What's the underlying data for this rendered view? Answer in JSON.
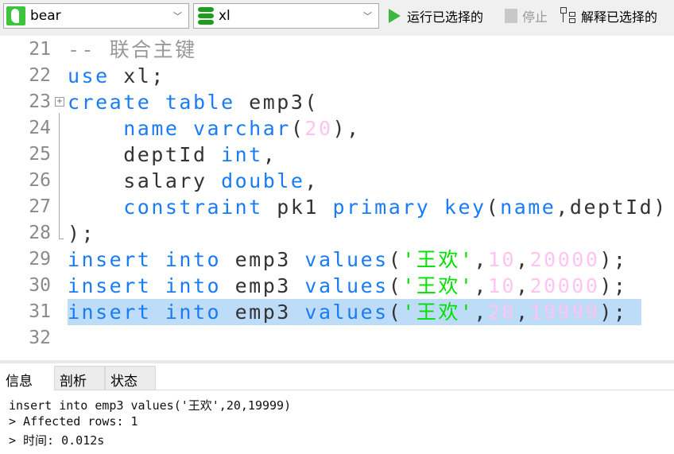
{
  "toolbar": {
    "connection": "bear",
    "database": "xl",
    "run_selected": "运行已选择的",
    "stop": "停止",
    "explain_selected": "解释已选择的"
  },
  "editor": {
    "lines": [
      {
        "num": "21",
        "tokens": [
          [
            "c",
            "-- 联合主键"
          ]
        ]
      },
      {
        "num": "22",
        "tokens": [
          [
            "k",
            "use"
          ],
          [
            "p",
            " xl;"
          ]
        ]
      },
      {
        "num": "23",
        "fold": true,
        "tokens": [
          [
            "k",
            "create table"
          ],
          [
            "p",
            " emp3("
          ]
        ]
      },
      {
        "num": "24",
        "tokens": [
          [
            "p",
            "    "
          ],
          [
            "k",
            "name varchar"
          ],
          [
            "p",
            "("
          ],
          [
            "n",
            "20"
          ],
          [
            "p",
            "),"
          ]
        ]
      },
      {
        "num": "25",
        "tokens": [
          [
            "p",
            "    deptId "
          ],
          [
            "k",
            "int"
          ],
          [
            "p",
            ","
          ]
        ]
      },
      {
        "num": "26",
        "tokens": [
          [
            "p",
            "    salary "
          ],
          [
            "k",
            "double"
          ],
          [
            "p",
            ","
          ]
        ]
      },
      {
        "num": "27",
        "tokens": [
          [
            "p",
            "    "
          ],
          [
            "k",
            "constraint"
          ],
          [
            "p",
            " pk1 "
          ],
          [
            "k",
            "primary key"
          ],
          [
            "p",
            "("
          ],
          [
            "k",
            "name"
          ],
          [
            "p",
            ",deptId)"
          ]
        ]
      },
      {
        "num": "28",
        "tokens": [
          [
            "p",
            ");"
          ]
        ]
      },
      {
        "num": "29",
        "tokens": [
          [
            "k",
            "insert into"
          ],
          [
            "p",
            " emp3 "
          ],
          [
            "k",
            "values"
          ],
          [
            "p",
            "("
          ],
          [
            "s",
            "'王欢'"
          ],
          [
            "p",
            ","
          ],
          [
            "n",
            "10"
          ],
          [
            "p",
            ","
          ],
          [
            "n",
            "20000"
          ],
          [
            "p",
            ");"
          ]
        ]
      },
      {
        "num": "30",
        "tokens": [
          [
            "k",
            "insert into"
          ],
          [
            "p",
            " emp3 "
          ],
          [
            "k",
            "values"
          ],
          [
            "p",
            "("
          ],
          [
            "s",
            "'王欢'"
          ],
          [
            "p",
            ","
          ],
          [
            "n",
            "10"
          ],
          [
            "p",
            ","
          ],
          [
            "n",
            "20000"
          ],
          [
            "p",
            ");"
          ]
        ]
      },
      {
        "num": "31",
        "selected": true,
        "tokens": [
          [
            "k",
            "insert into"
          ],
          [
            "p",
            " emp3 "
          ],
          [
            "k",
            "values"
          ],
          [
            "p",
            "("
          ],
          [
            "s",
            "'王欢'"
          ],
          [
            "p",
            ","
          ],
          [
            "n",
            "20"
          ],
          [
            "p",
            ","
          ],
          [
            "n",
            "19999"
          ],
          [
            "p",
            ");"
          ]
        ]
      },
      {
        "num": "32",
        "tokens": []
      }
    ]
  },
  "panel": {
    "tabs": [
      "信息",
      "剖析",
      "状态"
    ],
    "output": [
      "insert into emp3 values('王欢',20,19999)",
      "> Affected rows: 1",
      "> 时间: 0.012s"
    ]
  },
  "colors": {
    "keyword": "#1a7cf5",
    "string": "#00e000",
    "number": "#ffc4f2",
    "comment": "#999999",
    "selection": "#bddcf7"
  }
}
